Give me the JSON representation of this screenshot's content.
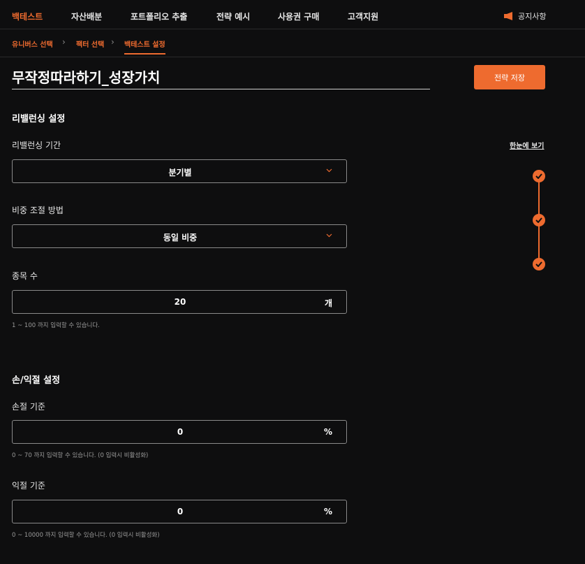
{
  "nav": {
    "items": [
      "백테스트",
      "자산배분",
      "포트폴리오 추출",
      "전략 예시",
      "사용권 구매",
      "고객지원"
    ],
    "notice_label": "공지사항"
  },
  "breadcrumb": {
    "items": [
      "유니버스 선택",
      "팩터 선택",
      "백테스트 설정"
    ]
  },
  "strategy": {
    "name": "무작정따라하기_성장가치",
    "save_label": "전략 저장"
  },
  "rebalancing": {
    "section_title": "리밸런싱 설정",
    "period_label": "리밸런싱 기간",
    "period_value": "분기별",
    "weight_label": "비중 조절 방법",
    "weight_value": "동일 비중",
    "count_label": "종목 수",
    "count_value": "20",
    "count_unit": "개",
    "count_help": "1 ~ 100 까지 입력할 수 있습니다."
  },
  "profit_loss": {
    "section_title": "손/익절 설정",
    "stop_loss_label": "손절 기준",
    "stop_loss_value": "0",
    "stop_loss_unit": "%",
    "stop_loss_help": "0 ~ 70 까지 입력할 수 있습니다. (0 입력시 비활성화)",
    "take_profit_label": "익절 기준",
    "take_profit_value": "0",
    "take_profit_unit": "%",
    "take_profit_help": "0 ~ 10000 까지 입력할 수 있습니다. (0 입력시 비활성화)"
  },
  "overview": {
    "view_all_label": "한눈에 보기",
    "steps_completed": 3
  },
  "colors": {
    "accent": "#ee6b2f",
    "background": "#0e0e0f"
  }
}
